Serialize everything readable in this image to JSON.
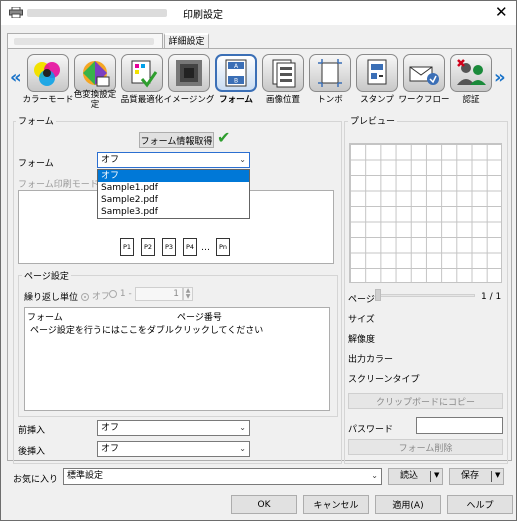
{
  "window": {
    "title": "印刷設定",
    "close_glyph": "✕"
  },
  "tabs": {
    "detail": "詳細設定"
  },
  "toolbar": {
    "items": [
      {
        "label": "カラーモード",
        "icon": "color-mode-icon",
        "glyph": "●"
      },
      {
        "label": "色変換設定",
        "label2": "定",
        "icon": "color-convert-icon",
        "glyph": "◆"
      },
      {
        "label": "品質最適化",
        "icon": "quality-icon",
        "glyph": "▦"
      },
      {
        "label": "イメージング",
        "icon": "imaging-icon",
        "glyph": "■"
      },
      {
        "label": "フォーム",
        "icon": "form-icon",
        "glyph": "▤"
      },
      {
        "label": "画像位置",
        "icon": "image-position-icon",
        "glyph": "▥"
      },
      {
        "label": "トンボ",
        "icon": "crop-marks-icon",
        "glyph": "⌗"
      },
      {
        "label": "スタンプ",
        "icon": "stamp-icon",
        "glyph": "▧"
      },
      {
        "label": "ワークフロー",
        "icon": "workflow-icon",
        "glyph": "✉"
      },
      {
        "label": "認証",
        "icon": "authentication-icon",
        "glyph": "✖"
      }
    ],
    "left_arrow": "«",
    "right_arrow": "»"
  },
  "form_section": {
    "group_label": "フォーム",
    "get_info_button": "フォーム情報取得",
    "check": "✔",
    "form_label": "フォーム",
    "form_value": "オフ",
    "print_mode_label": "フォーム印刷モード",
    "dropdown_options": [
      "オフ",
      "Sample1.pdf",
      "Sample2.pdf",
      "Sample3.pdf"
    ],
    "pages": [
      "P1",
      "P2",
      "P3",
      "P4",
      "…",
      "Pn"
    ]
  },
  "page_settings": {
    "group_label": "ページ設定",
    "repeat_unit_label": "繰り返し単位",
    "radio_off": "オフ",
    "radio_1": "1 -",
    "spin_value": "1",
    "col_form": "フォーム",
    "col_page": "ページ番号",
    "hint": "ページ設定を行うにはここをダブルクリックしてください"
  },
  "inserts": {
    "front_label": "前挿入",
    "front_value": "オフ",
    "back_label": "後挿入",
    "back_value": "オフ"
  },
  "preview": {
    "group_label": "プレビュー",
    "page_label": "ページ",
    "page_count": "1 / 1",
    "size_label": "サイズ",
    "resolution_label": "解像度",
    "output_color_label": "出力カラー",
    "screen_type_label": "スクリーンタイプ",
    "copy_button": "クリップボードにコピー",
    "password_label": "パスワード",
    "delete_form_button": "フォーム削除"
  },
  "favorites": {
    "label": "お気に入り",
    "value": "標準設定",
    "load_button": "読込",
    "save_button": "保存"
  },
  "footer": {
    "ok": "OK",
    "cancel": "キャンセル",
    "apply": "適用(A)",
    "help": "ヘルプ"
  },
  "colors": {
    "accent": "#0078d7",
    "check_green": "#2e9e2e",
    "chevron_blue": "#1a73c9"
  }
}
